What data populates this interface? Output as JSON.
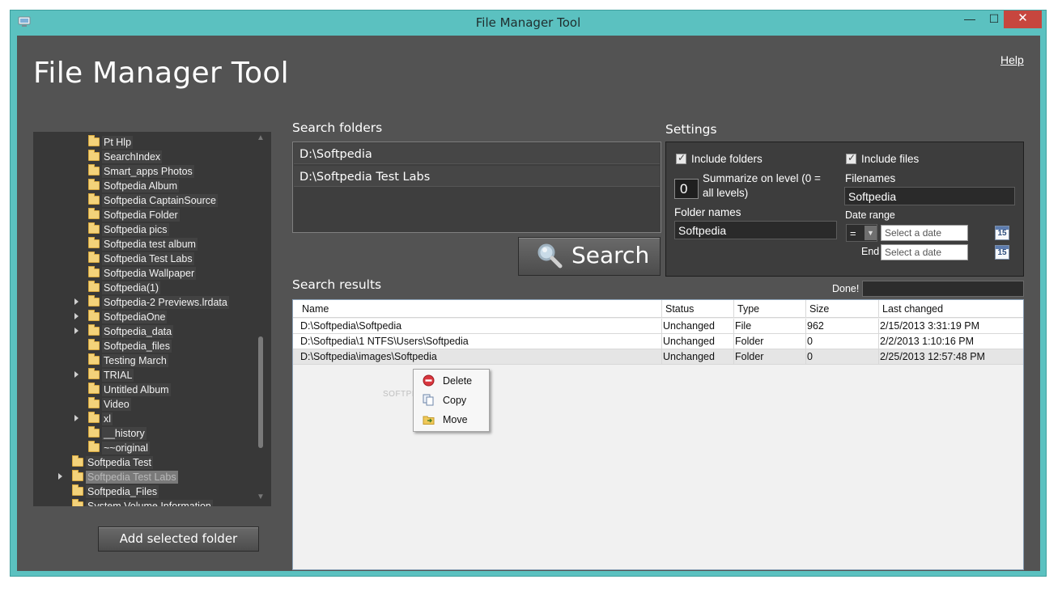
{
  "window": {
    "title": "File Manager Tool",
    "minimize": "—",
    "maximize": "☐",
    "close": "✕"
  },
  "app": {
    "heading": "File Manager Tool",
    "help_label": "Help"
  },
  "tree": {
    "items": [
      {
        "label": "Pt Hlp",
        "expander": false
      },
      {
        "label": "SearchIndex",
        "expander": false
      },
      {
        "label": "Smart_apps Photos",
        "expander": false
      },
      {
        "label": "Softpedia Album",
        "expander": false
      },
      {
        "label": "Softpedia CaptainSource",
        "expander": false
      },
      {
        "label": "Softpedia Folder",
        "expander": false
      },
      {
        "label": "Softpedia pics",
        "expander": false
      },
      {
        "label": "Softpedia test album",
        "expander": false
      },
      {
        "label": "Softpedia Test Labs",
        "expander": false
      },
      {
        "label": "Softpedia Wallpaper",
        "expander": false
      },
      {
        "label": "Softpedia(1)",
        "expander": false
      },
      {
        "label": "Softpedia-2 Previews.lrdata",
        "expander": true
      },
      {
        "label": "SoftpediaOne",
        "expander": true
      },
      {
        "label": "Softpedia_data",
        "expander": true
      },
      {
        "label": "Softpedia_files",
        "expander": false
      },
      {
        "label": "Testing March",
        "expander": false
      },
      {
        "label": "TRIAL",
        "expander": true
      },
      {
        "label": "Untitled Album",
        "expander": false
      },
      {
        "label": "Video",
        "expander": false
      },
      {
        "label": "xl",
        "expander": true
      },
      {
        "label": "__history",
        "expander": false
      },
      {
        "label": "~~original",
        "expander": false
      },
      {
        "label": "Softpedia Test",
        "expander": false
      },
      {
        "label": "Softpedia Test Labs",
        "expander": true
      },
      {
        "label": "Softpedia_Files",
        "expander": false
      },
      {
        "label": "System Volume Information",
        "expander": false
      }
    ],
    "add_button": "Add selected folder"
  },
  "search_folders": {
    "title": "Search folders",
    "items": [
      "D:\\Softpedia",
      "D:\\Softpedia Test Labs"
    ],
    "search_button": "Search"
  },
  "settings": {
    "title": "Settings",
    "include_folders": "Include folders",
    "include_files": "Include files",
    "summarize_label": "Summarize on level (0 =",
    "summarize_label2": "all levels)",
    "level_value": "0",
    "filenames_label": "Filenames",
    "filenames_value": "Softpedia",
    "folder_names_label": "Folder names",
    "folder_names_value": "Softpedia",
    "date_range_label": "Date range",
    "operator": "=",
    "start_placeholder": "Select a date",
    "end_label": "End",
    "end_placeholder": "Select a date",
    "calendar_day": "15"
  },
  "results": {
    "title": "Search results",
    "done_label": "Done!",
    "columns": [
      "Name",
      "Status",
      "Type",
      "Size",
      "Last changed"
    ],
    "rows": [
      [
        "D:\\Softpedia\\Softpedia",
        "Unchanged",
        "File",
        "962",
        "2/15/2013 3:31:19 PM"
      ],
      [
        "D:\\Softpedia\\1 NTFS\\Users\\Softpedia",
        "Unchanged",
        "Folder",
        "0",
        "2/2/2013 1:10:16 PM"
      ],
      [
        "D:\\Softpedia\\images\\Softpedia",
        "Unchanged",
        "Folder",
        "0",
        "2/25/2013 12:57:48 PM"
      ]
    ]
  },
  "context_menu": {
    "items": [
      "Delete",
      "Copy",
      "Move"
    ]
  },
  "watermark": "SOFTPEDIA",
  "colors": {
    "frame": "#5bc1c0",
    "client": "#535353",
    "close_button": "#c7463e"
  }
}
